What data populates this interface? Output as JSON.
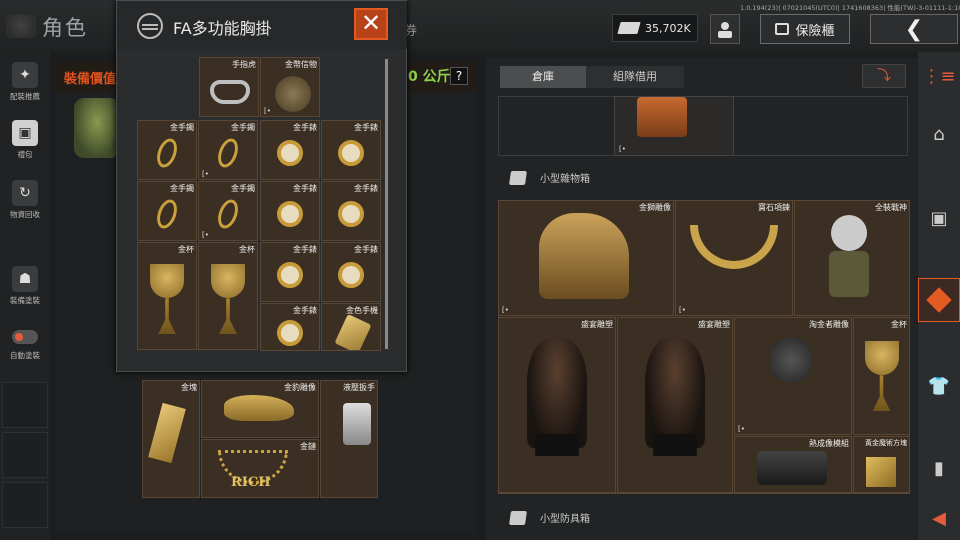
{
  "topbar": {
    "title": "角色",
    "tab_partial": "券",
    "version": "1.0.194(23)| 07021045(UTC0)| 1741608363| 性能(TW)-3-01111-1:100 zh-TW",
    "money": "35,702K",
    "safe_label": "保險櫃",
    "back_icon": "chevron-left-icon"
  },
  "left_sidebar": {
    "items": [
      {
        "label": "配裝推薦",
        "icon": "gun-icon"
      },
      {
        "label": "禮包",
        "icon": "gift-icon"
      },
      {
        "label": "物資回收",
        "icon": "recycle-icon"
      },
      {
        "label": "裝備塗裝",
        "icon": "helmet-icon"
      },
      {
        "label": "自動塗裝",
        "icon": "toggle-icon"
      }
    ]
  },
  "equipment": {
    "value_label": "裝備價值",
    "weight": "0 公斤",
    "help": "?"
  },
  "popup": {
    "title": "FA多功能胸掛",
    "close": "✕",
    "mark": "[•",
    "items_row0": [
      {
        "name": "手指虎",
        "icon": "brass-knuckle"
      },
      {
        "name": "金幣信物",
        "icon": "gold-coin"
      }
    ],
    "items_grid": [
      {
        "name": "金手鐲",
        "icon": "gold-bracelet"
      },
      {
        "name": "金手鐲",
        "icon": "gold-bracelet"
      },
      {
        "name": "金手錶",
        "icon": "gold-watch"
      },
      {
        "name": "金手錶",
        "icon": "gold-watch"
      },
      {
        "name": "金手鐲",
        "icon": "gold-bracelet"
      },
      {
        "name": "金手鐲",
        "icon": "gold-bracelet"
      },
      {
        "name": "金手錶",
        "icon": "gold-watch"
      },
      {
        "name": "金手錶",
        "icon": "gold-watch"
      },
      {
        "name": "金杯",
        "icon": "gold-cup"
      },
      {
        "name": "金杯",
        "icon": "gold-cup"
      },
      {
        "name": "金手錶",
        "icon": "gold-watch"
      },
      {
        "name": "金手錶",
        "icon": "gold-watch"
      },
      {
        "name": "金手錶",
        "icon": "gold-watch"
      },
      {
        "name": "金色手機",
        "icon": "gold-phone"
      }
    ]
  },
  "lower_left_items": [
    {
      "name": "金塊",
      "icon": "gold-bar"
    },
    {
      "name": "金豹雕像",
      "icon": "gold-leopard"
    },
    {
      "name": "液壓扳手",
      "icon": "hydraulic-wrench"
    },
    {
      "name": "金鏈",
      "icon": "gold-chain"
    }
  ],
  "right_panel": {
    "tabs": [
      "倉庫",
      "組隊借用"
    ],
    "sort_icon": "sort-icon",
    "section_small_box": "小型雜物箱",
    "section_small_armor": "小型防具箱",
    "box_items": [
      {
        "name": "金獅雕像",
        "icon": "gold-lion"
      },
      {
        "name": "寶石項鍊",
        "icon": "gem-necklace"
      },
      {
        "name": "全裝戰神",
        "icon": "armored-figure"
      },
      {
        "name": "盛宴雕塑",
        "icon": "bust-statue"
      },
      {
        "name": "盛宴雕塑",
        "icon": "bust-statue"
      },
      {
        "name": "淘金者雕像",
        "icon": "miner-figure"
      },
      {
        "name": "金杯",
        "icon": "gold-cup"
      },
      {
        "name": "熱成像模組",
        "icon": "thermal-module"
      },
      {
        "name": "黃金魔術方塊",
        "icon": "gold-cube"
      }
    ]
  },
  "right_nav": {
    "items": [
      "grid-icon",
      "home-icon",
      "backpack-icon",
      "box-icon",
      "shirt-icon",
      "magazine-icon",
      "arrow-left-icon"
    ]
  }
}
